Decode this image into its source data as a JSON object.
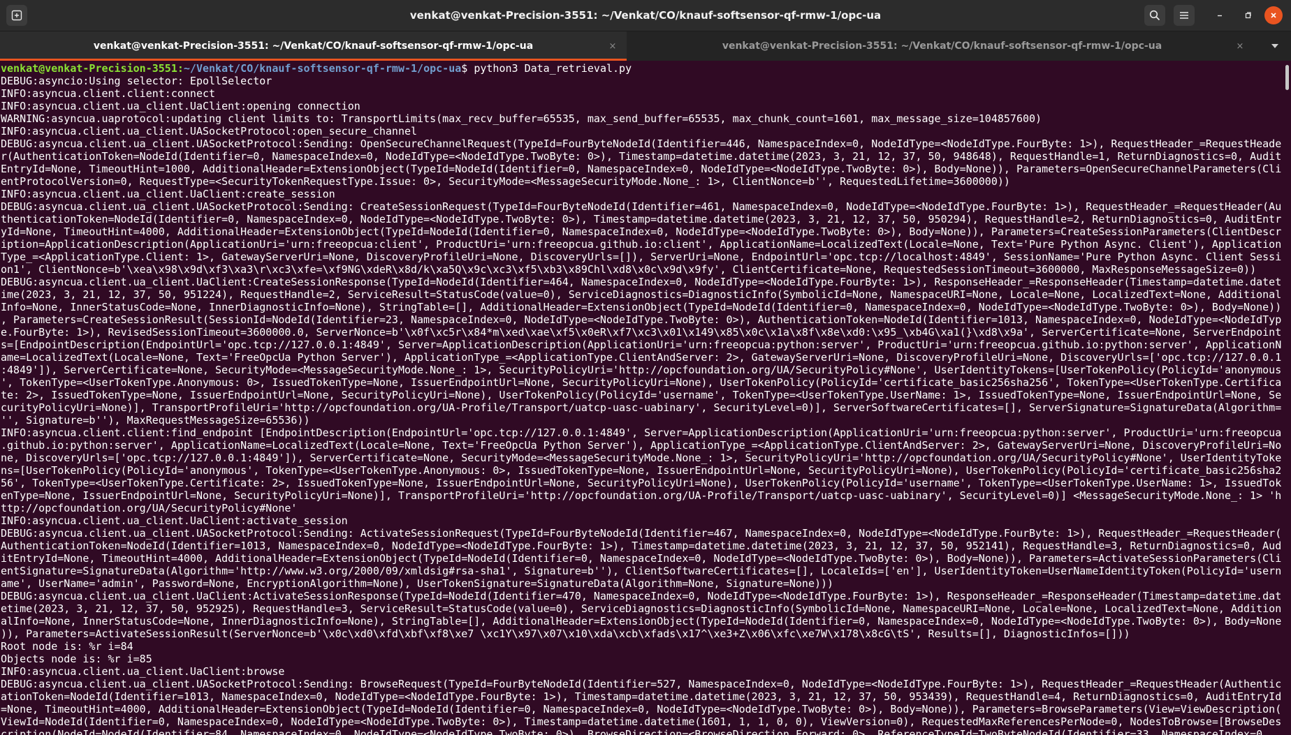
{
  "window": {
    "title": "venkat@venkat-Precision-3551: ~/Venkat/CO/knauf-softsensor-qf-rmw-1/opc-ua",
    "icons": {
      "new_tab": "new-tab-icon",
      "search": "search-icon",
      "menu": "hamburger-menu-icon",
      "minimize": "minimize-icon",
      "maximize": "maximize-icon",
      "close": "close-icon"
    },
    "accent_color": "#e95420",
    "background_color": "#300a24"
  },
  "tabs": [
    {
      "label": "venkat@venkat-Precision-3551: ~/Venkat/CO/knauf-softsensor-qf-rmw-1/opc-ua",
      "active": true,
      "close": "×"
    },
    {
      "label": "venkat@venkat-Precision-3551: ~/Venkat/CO/knauf-softsensor-qf-rmw-1/opc-ua",
      "active": false,
      "close": "×"
    }
  ],
  "terminal": {
    "prompt": {
      "user_host": "venkat@venkat-Precision-3551",
      "separator": ":",
      "path": "~/Venkat/CO/knauf-softsensor-qf-rmw-1/opc-ua",
      "symbol": "$ ",
      "command": "python3 Data_retrieval.py"
    },
    "lines": [
      "DEBUG:asyncio:Using selector: EpollSelector",
      "INFO:asyncua.client.client:connect",
      "INFO:asyncua.client.ua_client.UaClient:opening connection",
      "WARNING:asyncua.uaprotocol:updating client limits to: TransportLimits(max_recv_buffer=65535, max_send_buffer=65535, max_chunk_count=1601, max_message_size=104857600)",
      "INFO:asyncua.client.ua_client.UASocketProtocol:open_secure_channel",
      "DEBUG:asyncua.client.ua_client.UASocketProtocol:Sending: OpenSecureChannelRequest(TypeId=FourByteNodeId(Identifier=446, NamespaceIndex=0, NodeIdType=<NodeIdType.FourByte: 1>), RequestHeader_=RequestHeade",
      "r(AuthenticationToken=NodeId(Identifier=0, NamespaceIndex=0, NodeIdType=<NodeIdType.TwoByte: 0>), Timestamp=datetime.datetime(2023, 3, 21, 12, 37, 50, 948648), RequestHandle=1, ReturnDiagnostics=0, Audit",
      "EntryId=None, TimeoutHint=1000, AdditionalHeader=ExtensionObject(TypeId=NodeId(Identifier=0, NamespaceIndex=0, NodeIdType=<NodeIdType.TwoByte: 0>), Body=None)), Parameters=OpenSecureChannelParameters(Cli",
      "entProtocolVersion=0, RequestType=<SecurityTokenRequestType.Issue: 0>, SecurityMode=<MessageSecurityMode.None_: 1>, ClientNonce=b'', RequestedLifetime=3600000))",
      "INFO:asyncua.client.ua_client.UaClient:create_session",
      "DEBUG:asyncua.client.ua_client.UASocketProtocol:Sending: CreateSessionRequest(TypeId=FourByteNodeId(Identifier=461, NamespaceIndex=0, NodeIdType=<NodeIdType.FourByte: 1>), RequestHeader_=RequestHeader(Au",
      "thenticationToken=NodeId(Identifier=0, NamespaceIndex=0, NodeIdType=<NodeIdType.TwoByte: 0>), Timestamp=datetime.datetime(2023, 3, 21, 12, 37, 50, 950294), RequestHandle=2, ReturnDiagnostics=0, AuditEntr",
      "yId=None, TimeoutHint=4000, AdditionalHeader=ExtensionObject(TypeId=NodeId(Identifier=0, NamespaceIndex=0, NodeIdType=<NodeIdType.TwoByte: 0>), Body=None)), Parameters=CreateSessionParameters(ClientDescr",
      "iption=ApplicationDescription(ApplicationUri='urn:freeopcua:client', ProductUri='urn:freeopcua.github.io:client', ApplicationName=LocalizedText(Locale=None, Text='Pure Python Async. Client'), Application",
      "Type_=<ApplicationType.Client: 1>, GatewayServerUri=None, DiscoveryProfileUri=None, DiscoveryUrls=[]), ServerUri=None, EndpointUrl='opc.tcp://localhost:4849', SessionName='Pure Python Async. Client Sessi",
      "on1', ClientNonce=b'\\xea\\x98\\x9d\\xf3\\xa3\\r\\xc3\\xfe=\\xf9NG\\xdeR\\x8d/k\\xa5Q\\x9c\\xc3\\xf5\\xb3\\x89Chl\\xd8\\x0c\\x9d\\x9fy', ClientCertificate=None, RequestedSessionTimeout=3600000, MaxResponseMessageSize=0))",
      "DEBUG:asyncua.client.ua_client.UaClient:CreateSessionResponse(TypeId=NodeId(Identifier=464, NamespaceIndex=0, NodeIdType=<NodeIdType.FourByte: 1>), ResponseHeader_=ResponseHeader(Timestamp=datetime.datet",
      "ime(2023, 3, 21, 12, 37, 50, 951224), RequestHandle=2, ServiceResult=StatusCode(value=0), ServiceDiagnostics=DiagnosticInfo(SymbolicId=None, NamespaceURI=None, Locale=None, LocalizedText=None, Additional",
      "Info=None, InnerStatusCode=None, InnerDiagnosticInfo=None), StringTable=[], AdditionalHeader=ExtensionObject(TypeId=NodeId(Identifier=0, NamespaceIndex=0, NodeIdType=<NodeIdType.TwoByte: 0>), Body=None))",
      ", Parameters=CreateSessionResult(SessionId=NodeId(Identifier=23, NamespaceIndex=0, NodeIdType=<NodeIdType.TwoByte: 0>), AuthenticationToken=NodeId(Identifier=1013, NamespaceIndex=0, NodeIdType=<NodeIdTyp",
      "e.FourByte: 1>), RevisedSessionTimeout=3600000.0, ServerNonce=b'\\x0f\\xc5r\\x84*m\\xed\\xae\\xf5\\x0eR\\xf7\\xc3\\x01\\x149\\x85\\x0c\\x1a\\x8f\\x8e\\xd0:\\x95_\\xb4G\\xa1(}\\xd8\\x9a', ServerCertificate=None, ServerEndpoint",
      "s=[EndpointDescription(EndpointUrl='opc.tcp://127.0.0.1:4849', Server=ApplicationDescription(ApplicationUri='urn:freeopcua:python:server', ProductUri='urn:freeopcua.github.io:python:server', ApplicationN",
      "ame=LocalizedText(Locale=None, Text='FreeOpcUa Python Server'), ApplicationType_=<ApplicationType.ClientAndServer: 2>, GatewayServerUri=None, DiscoveryProfileUri=None, DiscoveryUrls=['opc.tcp://127.0.0.1",
      ":4849']), ServerCertificate=None, SecurityMode=<MessageSecurityMode.None_: 1>, SecurityPolicyUri='http://opcfoundation.org/UA/SecurityPolicy#None', UserIdentityTokens=[UserTokenPolicy(PolicyId='anonymous",
      "', TokenType=<UserTokenType.Anonymous: 0>, IssuedTokenType=None, IssuerEndpointUrl=None, SecurityPolicyUri=None), UserTokenPolicy(PolicyId='certificate_basic256sha256', TokenType=<UserTokenType.Certifica",
      "te: 2>, IssuedTokenType=None, IssuerEndpointUrl=None, SecurityPolicyUri=None), UserTokenPolicy(PolicyId='username', TokenType=<UserTokenType.UserName: 1>, IssuedTokenType=None, IssuerEndpointUrl=None, Se",
      "curityPolicyUri=None)], TransportProfileUri='http://opcfoundation.org/UA-Profile/Transport/uatcp-uasc-uabinary', SecurityLevel=0)], ServerSoftwareCertificates=[], ServerSignature=SignatureData(Algorithm=",
      "'', Signature=b''), MaxRequestMessageSize=65536))",
      "INFO:asyncua.client.client:find_endpoint [EndpointDescription(EndpointUrl='opc.tcp://127.0.0.1:4849', Server=ApplicationDescription(ApplicationUri='urn:freeopcua:python:server', ProductUri='urn:freeopcua",
      ".github.io:python:server', ApplicationName=LocalizedText(Locale=None, Text='FreeOpcUa Python Server'), ApplicationType_=<ApplicationType.ClientAndServer: 2>, GatewayServerUri=None, DiscoveryProfileUri=No",
      "ne, DiscoveryUrls=['opc.tcp://127.0.0.1:4849']), ServerCertificate=None, SecurityMode=<MessageSecurityMode.None_: 1>, SecurityPolicyUri='http://opcfoundation.org/UA/SecurityPolicy#None', UserIdentityToke",
      "ns=[UserTokenPolicy(PolicyId='anonymous', TokenType=<UserTokenType.Anonymous: 0>, IssuedTokenType=None, IssuerEndpointUrl=None, SecurityPolicyUri=None), UserTokenPolicy(PolicyId='certificate_basic256sha2",
      "56', TokenType=<UserTokenType.Certificate: 2>, IssuedTokenType=None, IssuerEndpointUrl=None, SecurityPolicyUri=None), UserTokenPolicy(PolicyId='username', TokenType=<UserTokenType.UserName: 1>, IssuedTok",
      "enType=None, IssuerEndpointUrl=None, SecurityPolicyUri=None)], TransportProfileUri='http://opcfoundation.org/UA-Profile/Transport/uatcp-uasc-uabinary', SecurityLevel=0)] <MessageSecurityMode.None_: 1> 'h",
      "ttp://opcfoundation.org/UA/SecurityPolicy#None'",
      "INFO:asyncua.client.ua_client.UaClient:activate_session",
      "DEBUG:asyncua.client.ua_client.UASocketProtocol:Sending: ActivateSessionRequest(TypeId=FourByteNodeId(Identifier=467, NamespaceIndex=0, NodeIdType=<NodeIdType.FourByte: 1>), RequestHeader_=RequestHeader(",
      "AuthenticationToken=NodeId(Identifier=1013, NamespaceIndex=0, NodeIdType=<NodeIdType.FourByte: 1>), Timestamp=datetime.datetime(2023, 3, 21, 12, 37, 50, 952141), RequestHandle=3, ReturnDiagnostics=0, Aud",
      "itEntryId=None, TimeoutHint=4000, AdditionalHeader=ExtensionObject(TypeId=NodeId(Identifier=0, NamespaceIndex=0, NodeIdType=<NodeIdType.TwoByte: 0>), Body=None)), Parameters=ActivateSessionParameters(Cli",
      "entSignature=SignatureData(Algorithm='http://www.w3.org/2000/09/xmldsig#rsa-sha1', Signature=b''), ClientSoftwareCertificates=[], LocaleIds=['en'], UserIdentityToken=UserNameIdentityToken(PolicyId='usern",
      "ame', UserName='admin', Password=None, EncryptionAlgorithm=None), UserTokenSignature=SignatureData(Algorithm=None, Signature=None)))",
      "DEBUG:asyncua.client.ua_client.UaClient:ActivateSessionResponse(TypeId=NodeId(Identifier=470, NamespaceIndex=0, NodeIdType=<NodeIdType.FourByte: 1>), ResponseHeader_=ResponseHeader(Timestamp=datetime.dat",
      "etime(2023, 3, 21, 12, 37, 50, 952925), RequestHandle=3, ServiceResult=StatusCode(value=0), ServiceDiagnostics=DiagnosticInfo(SymbolicId=None, NamespaceURI=None, Locale=None, LocalizedText=None, Addition",
      "alInfo=None, InnerStatusCode=None, InnerDiagnosticInfo=None), StringTable=[], AdditionalHeader=ExtensionObject(TypeId=NodeId(Identifier=0, NamespaceIndex=0, NodeIdType=<NodeIdType.TwoByte: 0>), Body=None",
      ")), Parameters=ActivateSessionResult(ServerNonce=b'\\x0c\\xd0\\xfd\\xbf\\xf8\\xe7 \\xc1Y\\x97\\x07\\x10\\xda\\xcb\\xfads\\x17^\\xe3+Z\\x06\\xfc\\xe7W\\x178\\x8cG\\tS', Results=[], DiagnosticInfos=[]))",
      "Root node is: %r i=84",
      "Objects node is: %r i=85",
      "INFO:asyncua.client.ua_client.UaClient:browse",
      "DEBUG:asyncua.client.ua_client.UASocketProtocol:Sending: BrowseRequest(TypeId=FourByteNodeId(Identifier=527, NamespaceIndex=0, NodeIdType=<NodeIdType.FourByte: 1>), RequestHeader_=RequestHeader(Authentic",
      "ationToken=NodeId(Identifier=1013, NamespaceIndex=0, NodeIdType=<NodeIdType.FourByte: 1>), Timestamp=datetime.datetime(2023, 3, 21, 12, 37, 50, 953439), RequestHandle=4, ReturnDiagnostics=0, AuditEntryId",
      "=None, TimeoutHint=4000, AdditionalHeader=ExtensionObject(TypeId=NodeId(Identifier=0, NamespaceIndex=0, NodeIdType=<NodeIdType.TwoByte: 0>), Body=None)), Parameters=BrowseParameters(View=ViewDescription(",
      "ViewId=NodeId(Identifier=0, NamespaceIndex=0, NodeIdType=<NodeIdType.TwoByte: 0>), Timestamp=datetime.datetime(1601, 1, 1, 0, 0), ViewVersion=0), RequestedMaxReferencesPerNode=0, NodesToBrowse=[BrowseDes",
      "cription(NodeId=NodeId(Identifier=84, NamespaceIndex=0, NodeIdType=<NodeIdType.TwoByte: 0>), BrowseDirection=<BrowseDirection.Forward: 0>, ReferenceTypeId=TwoByteNodeId(Identifier=33, NamespaceIndex=0"
    ]
  }
}
